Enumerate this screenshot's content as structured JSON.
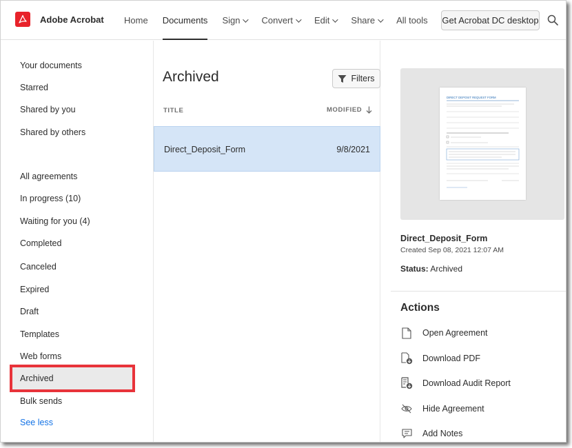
{
  "app": {
    "name": "Adobe Acrobat"
  },
  "nav": {
    "items": [
      {
        "label": "Home",
        "dropdown": false,
        "active": false
      },
      {
        "label": "Documents",
        "dropdown": false,
        "active": true
      },
      {
        "label": "Sign",
        "dropdown": true,
        "active": false
      },
      {
        "label": "Convert",
        "dropdown": true,
        "active": false
      },
      {
        "label": "Edit",
        "dropdown": true,
        "active": false
      },
      {
        "label": "Share",
        "dropdown": true,
        "active": false
      },
      {
        "label": "All tools",
        "dropdown": false,
        "active": false
      }
    ],
    "desktop_button": "Get Acrobat DC desktop"
  },
  "sidebar": {
    "documents": [
      "Your documents",
      "Starred",
      "Shared by you",
      "Shared by others"
    ],
    "agreements": [
      "All agreements",
      "In progress (10)",
      "Waiting for you (4)",
      "Completed",
      "Canceled",
      "Expired",
      "Draft",
      "Templates",
      "Web forms",
      "Archived",
      "Bulk sends"
    ],
    "selected": "Archived",
    "see_less": "See less"
  },
  "list": {
    "title": "Archived",
    "filters_label": "Filters",
    "col_title": "TITLE",
    "col_modified": "MODIFIED",
    "rows": [
      {
        "name": "Direct_Deposit_Form",
        "modified": "9/8/2021"
      }
    ]
  },
  "detail": {
    "preview_heading": "DIRECT DEPOSIT REQUEST FORM",
    "name": "Direct_Deposit_Form",
    "created": "Created Sep 08, 2021 12:07 AM",
    "status_label": "Status:",
    "status_value": "Archived",
    "actions_title": "Actions",
    "actions": [
      {
        "label": "Open Agreement",
        "icon": "document-icon"
      },
      {
        "label": "Download PDF",
        "icon": "download-pdf-icon"
      },
      {
        "label": "Download Audit Report",
        "icon": "audit-report-icon"
      },
      {
        "label": "Hide Agreement",
        "icon": "hide-icon"
      },
      {
        "label": "Add Notes",
        "icon": "notes-icon"
      }
    ]
  },
  "colors": {
    "brand": "#e8222a",
    "selected_row": "#d5e5f7",
    "link": "#1473e6",
    "annotation_box": "#e8333a"
  }
}
